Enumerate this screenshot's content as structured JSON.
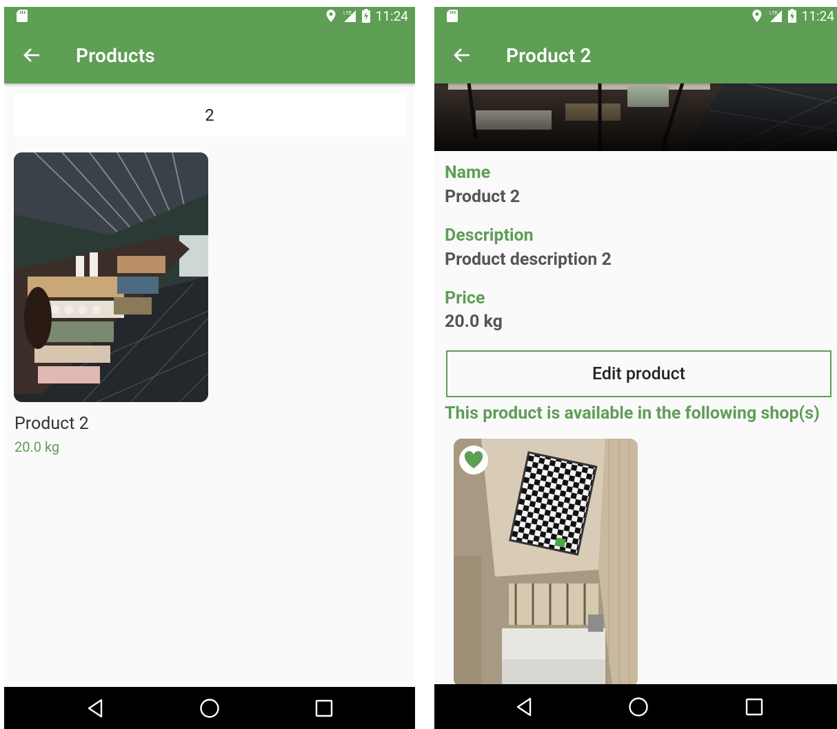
{
  "status_bar": {
    "time": "11:24"
  },
  "list_screen": {
    "title": "Products",
    "search_value": "2",
    "product": {
      "name": "Product 2",
      "price": "20.0 kg"
    }
  },
  "detail_screen": {
    "title": "Product 2",
    "name_label": "Name",
    "name_value": "Product 2",
    "description_label": "Description",
    "description_value": "Product description 2",
    "price_label": "Price",
    "price_value": "20.0 kg",
    "edit_button": "Edit product",
    "availability_text": "This product is available in the following shop(s)"
  },
  "icons": [
    "sd-card-icon",
    "location-icon",
    "lte-signal-icon",
    "battery-charging-icon",
    "back-arrow-icon",
    "nav-back-icon",
    "nav-home-icon",
    "nav-recents-icon",
    "heart-icon"
  ],
  "colors": {
    "primary": "#5e9e55",
    "background": "#fafafa",
    "nav_bar": "#000000"
  }
}
